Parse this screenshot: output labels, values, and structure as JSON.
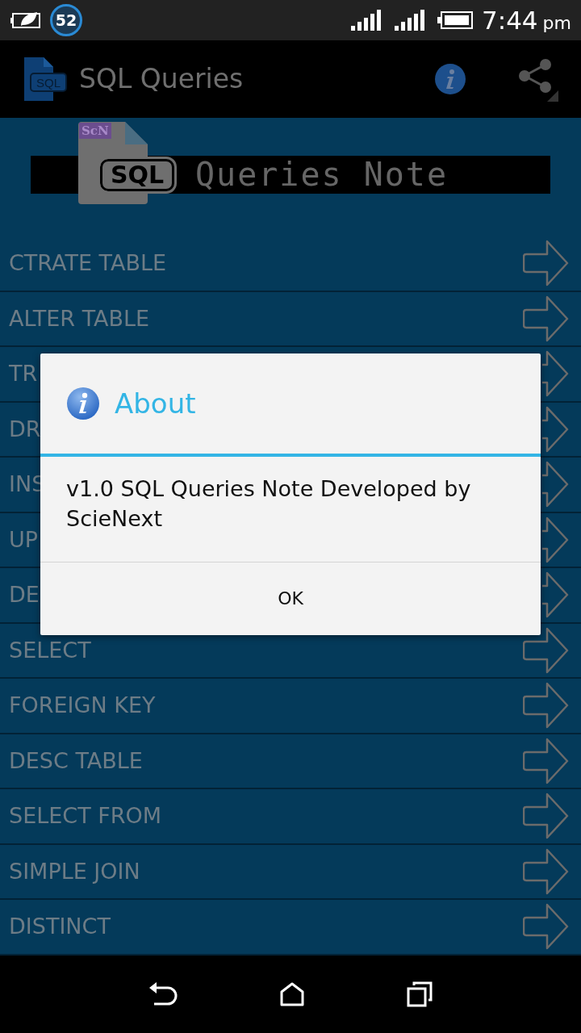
{
  "status_bar": {
    "notification_count": "52",
    "time": "7:44",
    "time_suffix": "pm"
  },
  "app_bar": {
    "icon_text": "SQL",
    "title": "SQL Queries"
  },
  "banner": {
    "badge": "ScN",
    "logo_text": "SQL",
    "title": "Queries Note"
  },
  "items": [
    {
      "label": "CTRATE TABLE"
    },
    {
      "label": "ALTER TABLE"
    },
    {
      "label": "TR"
    },
    {
      "label": "DR"
    },
    {
      "label": "INS"
    },
    {
      "label": "UP"
    },
    {
      "label": "DE"
    },
    {
      "label": "SELECT"
    },
    {
      "label": "FOREIGN KEY"
    },
    {
      "label": "DESC TABLE"
    },
    {
      "label": "SELECT FROM"
    },
    {
      "label": "SIMPLE JOIN"
    },
    {
      "label": "DISTINCT"
    }
  ],
  "dialog": {
    "title": "About",
    "message": "v1.0 SQL Queries Note Developed by ScieNext",
    "button": "OK"
  }
}
